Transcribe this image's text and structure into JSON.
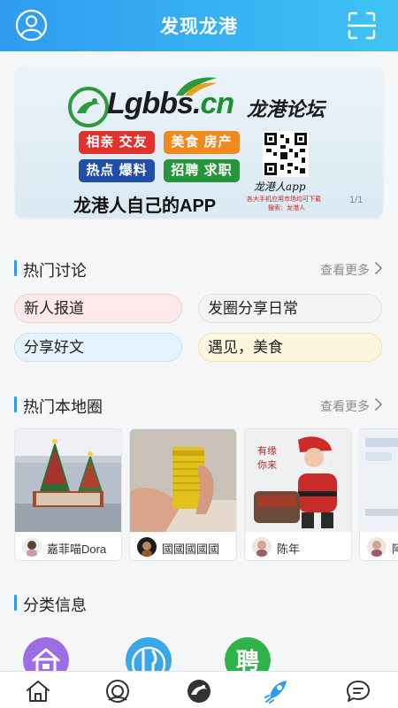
{
  "header": {
    "title": "发现龙港",
    "user_icon": "user-icon",
    "scan_icon": "scan-icon",
    "bg_color": "#33a8f2"
  },
  "banner": {
    "logo_text_main": "Lgbbs.",
    "logo_text_cn": "cn",
    "forum_name": "龙港论坛",
    "tags": [
      "相亲 交友",
      "美食 房产",
      "热点 爆料",
      "招聘 求职"
    ],
    "slogan": "龙港人自己的APP",
    "app_name": "龙港人app",
    "note_line1": "各大手机应用市场均可下载",
    "note_line2": "搜索：龙港人",
    "pager": "1/1"
  },
  "hot_discussion": {
    "title": "热门讨论",
    "more": "查看更多",
    "topics": [
      "新人报道",
      "发圈分享日常",
      "分享好文",
      "遇见，美食"
    ]
  },
  "hot_local": {
    "title": "热门本地圈",
    "more": "查看更多",
    "cards": [
      {
        "author": "嘉菲喵Dora"
      },
      {
        "author": "國國國國國"
      },
      {
        "author": "陈年"
      },
      {
        "author": "阿"
      }
    ]
  },
  "category": {
    "title": "分类信息",
    "items": [
      {
        "icon": "house-icon",
        "color": "#9b6ee6"
      },
      {
        "icon": "fork-knife-icon",
        "color": "#3aa7e8"
      },
      {
        "icon": "recruit-icon",
        "label": "聘",
        "color": "#2fb24a"
      }
    ]
  },
  "bottom_nav": {
    "items": [
      "home-icon",
      "discover-icon",
      "longgang-logo-icon",
      "rocket-icon",
      "message-icon"
    ],
    "active_index": 3,
    "active_color": "#2e9bf0"
  }
}
